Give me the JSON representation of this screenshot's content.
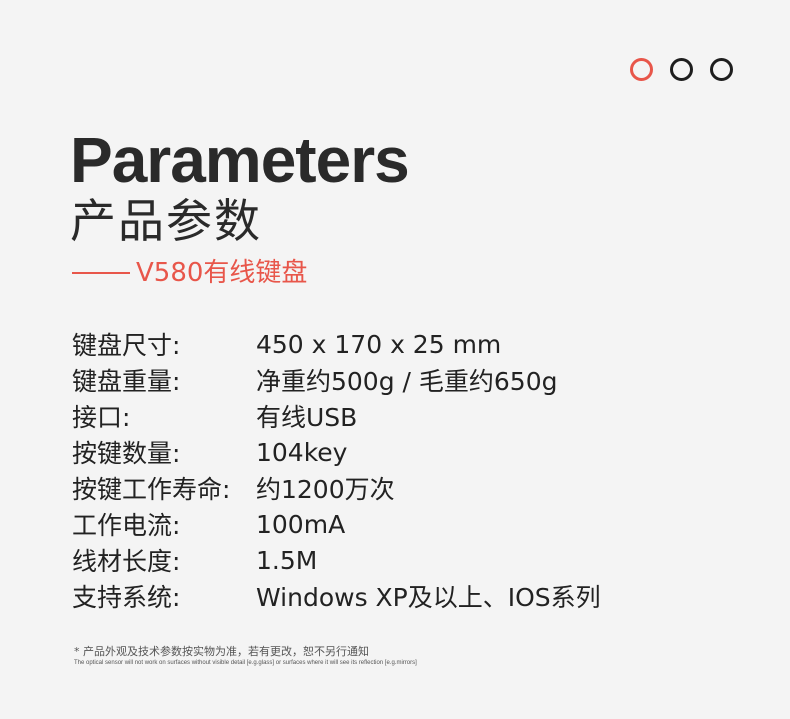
{
  "pager": {
    "dots": [
      {
        "state": "active",
        "color": "#e8564a"
      },
      {
        "state": "inactive",
        "color": "#1e1e1e"
      },
      {
        "state": "inactive",
        "color": "#1e1e1e"
      }
    ]
  },
  "header": {
    "title_en": "Parameters",
    "title_cn": "产品参数",
    "subtitle": "V580有线键盘"
  },
  "params": [
    {
      "label": "键盘尺寸:",
      "value": "450 x 170 x 25 mm"
    },
    {
      "label": "键盘重量:",
      "value": "净重约500g / 毛重约650g"
    },
    {
      "label": "接口:",
      "value": "有线USB"
    },
    {
      "label": "按键数量:",
      "value": "104key"
    },
    {
      "label": "按键工作寿命:",
      "value": "约1200万次"
    },
    {
      "label": "工作电流:",
      "value": "100mA"
    },
    {
      "label": "线材长度:",
      "value": "1.5M"
    },
    {
      "label": "支持系统:",
      "value": "Windows XP及以上、IOS系列"
    }
  ],
  "notes": {
    "cn": "* 产品外观及技术参数按实物为准，若有更改，恕不另行通知",
    "en": "The optical sensor will not work on surfaces without visible detail [e.g.glass] or surfaces where it will see its reflection [e.g.mirrors]"
  },
  "colors": {
    "accent": "#e8564a",
    "text": "#1e1e1e",
    "background": "#f4f4f4"
  }
}
